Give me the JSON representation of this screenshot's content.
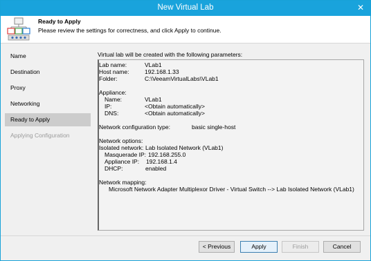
{
  "window": {
    "title": "New Virtual Lab",
    "close_glyph": "✕"
  },
  "header": {
    "title": "Ready to Apply",
    "description": "Please review the settings for correctness, and click Apply to continue.",
    "icon": "virtual-lab-icon"
  },
  "sidebar": {
    "items": [
      {
        "label": "Name",
        "state": "normal"
      },
      {
        "label": "Destination",
        "state": "normal"
      },
      {
        "label": "Proxy",
        "state": "normal"
      },
      {
        "label": "Networking",
        "state": "normal"
      },
      {
        "label": "Ready to Apply",
        "state": "active"
      },
      {
        "label": "Applying Configuration",
        "state": "disabled"
      }
    ]
  },
  "content": {
    "intro": "Virtual lab will be created with the following parameters:",
    "lab_name_label": "Lab name:",
    "lab_name": "VLab1",
    "host_name_label": "Host name:",
    "host_name": "192.168.1.33",
    "folder_label": "Folder:",
    "folder": "C:\\VeeamVirtualLabs\\VLab1",
    "appliance_heading": "Appliance:",
    "appliance_name_label": "Name:",
    "appliance_name": "VLab1",
    "appliance_ip_label": "IP:",
    "appliance_ip": "<Obtain automatically>",
    "appliance_dns_label": "DNS:",
    "appliance_dns": "<Obtain automatically>",
    "netconf_label": "Network configuration type:",
    "netconf": "basic single-host",
    "netopts_heading": "Network options:",
    "isolated_label": "Isolated network:",
    "isolated": "Lab Isolated Network (VLab1)",
    "masq_label": "Masquerade IP:",
    "masq": "192.168.255.0",
    "app_ip_label": "Appliance IP:",
    "app_ip": "192.168.1.4",
    "dhcp_label": "DHCP:",
    "dhcp": "enabled",
    "mapping_heading": "Network mapping:",
    "mapping": "Microsoft Network Adapter Multiplexor Driver - Virtual Switch --> Lab Isolated Network (VLab1)"
  },
  "buttons": {
    "previous": "< Previous",
    "apply": "Apply",
    "finish": "Finish",
    "cancel": "Cancel"
  },
  "colors": {
    "titlebar": "#19a3dc",
    "active_nav": "#cccccc",
    "primary_border": "#3c7fb1"
  }
}
